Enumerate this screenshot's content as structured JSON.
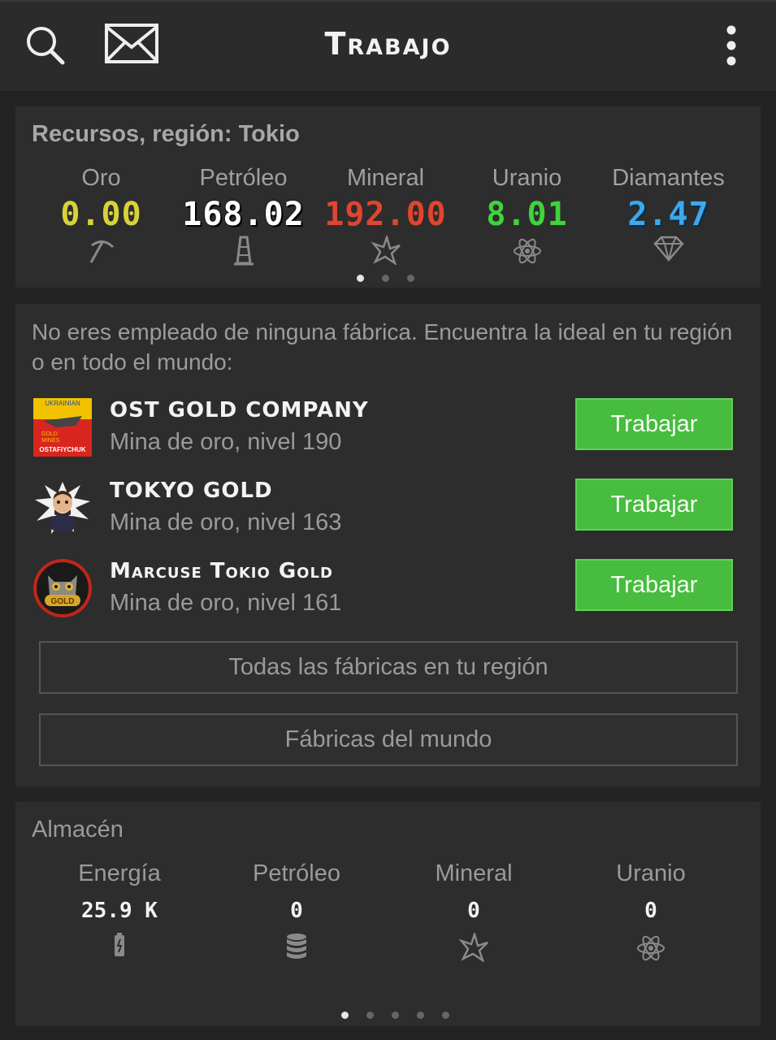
{
  "header": {
    "title": "Trabajo",
    "icons": [
      "search-icon",
      "mail-icon",
      "more-vert-icon"
    ]
  },
  "resources": {
    "title": "Recursos, región: Tokio",
    "items": [
      {
        "label": "Oro",
        "value": "0.00",
        "color": "#d8d23a",
        "icon": "pickaxe-icon"
      },
      {
        "label": "Petróleo",
        "value": "168.02",
        "color": "#ffffff",
        "icon": "oil-rig-icon"
      },
      {
        "label": "Mineral",
        "value": "192.00",
        "color": "#e0452f",
        "icon": "mineral-icon"
      },
      {
        "label": "Uranio",
        "value": "8.01",
        "color": "#3fd43b",
        "icon": "atom-icon"
      },
      {
        "label": "Diamantes",
        "value": "2.47",
        "color": "#3da8ec",
        "icon": "diamond-icon"
      }
    ],
    "pager": {
      "count": 3,
      "active": 0
    }
  },
  "factories": {
    "intro": "No eres empleado de ninguna fábrica. Encuentra la ideal en tu región o en todo el mundo:",
    "list": [
      {
        "name": "OST GOLD COMPANY",
        "subtitle": "Mina de oro, nivel 190",
        "button": "Trabajar",
        "logo_text": [
          "UKRAINIAN",
          "GOLD",
          "MINES",
          "OSTAFIYCHUK"
        ]
      },
      {
        "name": "TOKYO GOLD",
        "subtitle": "Mina de oro, nivel 163",
        "button": "Trabajar"
      },
      {
        "name": "Marcuse Tokio Gold",
        "subtitle": "Mina de oro, nivel 161",
        "button": "Trabajar",
        "logo_text": [
          "GOLD"
        ]
      }
    ],
    "region_button": "Todas las fábricas en tu región",
    "world_button": "Fábricas del mundo"
  },
  "storage": {
    "title": "Almacén",
    "items": [
      {
        "label": "Energía",
        "value": "25.9 K",
        "icon": "battery-icon"
      },
      {
        "label": "Petróleo",
        "value": "0",
        "icon": "barrel-icon"
      },
      {
        "label": "Mineral",
        "value": "0",
        "icon": "mineral-icon"
      },
      {
        "label": "Uranio",
        "value": "0",
        "icon": "atom-icon"
      }
    ],
    "pager": {
      "count": 5,
      "active": 0
    }
  }
}
